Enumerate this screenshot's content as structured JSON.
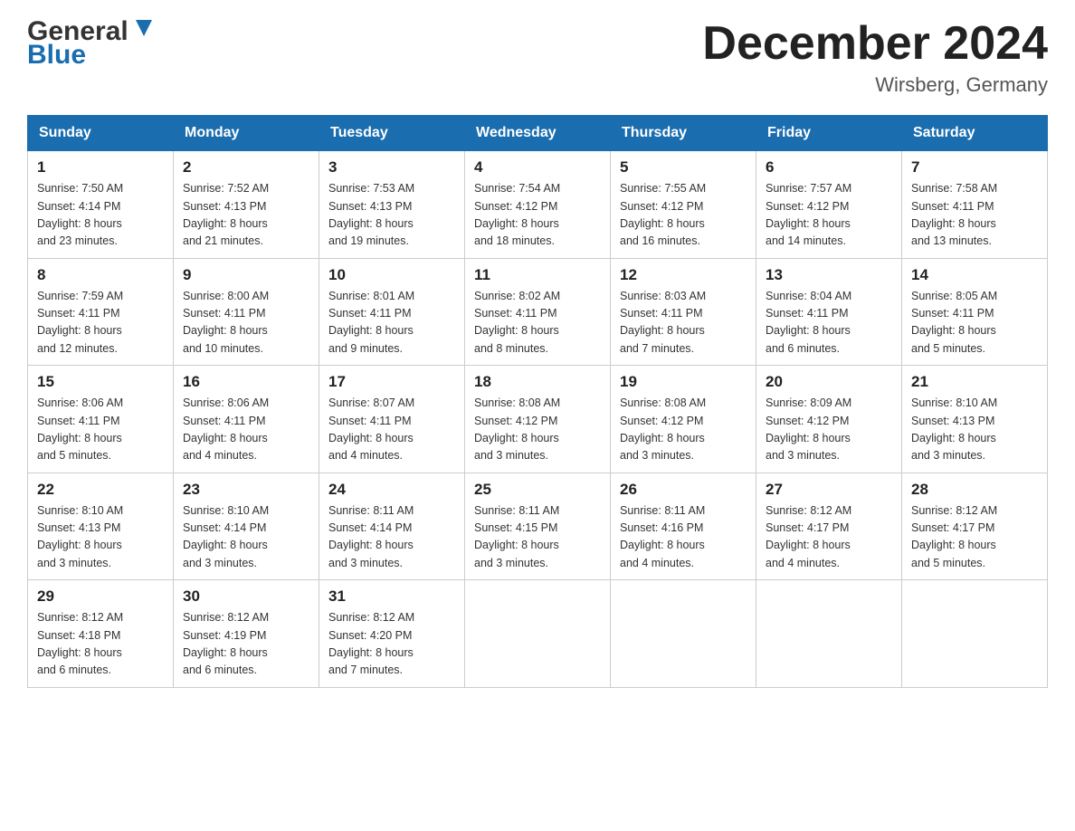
{
  "header": {
    "logo_line1": "General",
    "logo_line2": "Blue",
    "title": "December 2024",
    "subtitle": "Wirsberg, Germany"
  },
  "weekdays": [
    "Sunday",
    "Monday",
    "Tuesday",
    "Wednesday",
    "Thursday",
    "Friday",
    "Saturday"
  ],
  "weeks": [
    [
      {
        "day": "1",
        "sunrise": "7:50 AM",
        "sunset": "4:14 PM",
        "daylight": "8 hours and 23 minutes."
      },
      {
        "day": "2",
        "sunrise": "7:52 AM",
        "sunset": "4:13 PM",
        "daylight": "8 hours and 21 minutes."
      },
      {
        "day": "3",
        "sunrise": "7:53 AM",
        "sunset": "4:13 PM",
        "daylight": "8 hours and 19 minutes."
      },
      {
        "day": "4",
        "sunrise": "7:54 AM",
        "sunset": "4:12 PM",
        "daylight": "8 hours and 18 minutes."
      },
      {
        "day": "5",
        "sunrise": "7:55 AM",
        "sunset": "4:12 PM",
        "daylight": "8 hours and 16 minutes."
      },
      {
        "day": "6",
        "sunrise": "7:57 AM",
        "sunset": "4:12 PM",
        "daylight": "8 hours and 14 minutes."
      },
      {
        "day": "7",
        "sunrise": "7:58 AM",
        "sunset": "4:11 PM",
        "daylight": "8 hours and 13 minutes."
      }
    ],
    [
      {
        "day": "8",
        "sunrise": "7:59 AM",
        "sunset": "4:11 PM",
        "daylight": "8 hours and 12 minutes."
      },
      {
        "day": "9",
        "sunrise": "8:00 AM",
        "sunset": "4:11 PM",
        "daylight": "8 hours and 10 minutes."
      },
      {
        "day": "10",
        "sunrise": "8:01 AM",
        "sunset": "4:11 PM",
        "daylight": "8 hours and 9 minutes."
      },
      {
        "day": "11",
        "sunrise": "8:02 AM",
        "sunset": "4:11 PM",
        "daylight": "8 hours and 8 minutes."
      },
      {
        "day": "12",
        "sunrise": "8:03 AM",
        "sunset": "4:11 PM",
        "daylight": "8 hours and 7 minutes."
      },
      {
        "day": "13",
        "sunrise": "8:04 AM",
        "sunset": "4:11 PM",
        "daylight": "8 hours and 6 minutes."
      },
      {
        "day": "14",
        "sunrise": "8:05 AM",
        "sunset": "4:11 PM",
        "daylight": "8 hours and 5 minutes."
      }
    ],
    [
      {
        "day": "15",
        "sunrise": "8:06 AM",
        "sunset": "4:11 PM",
        "daylight": "8 hours and 5 minutes."
      },
      {
        "day": "16",
        "sunrise": "8:06 AM",
        "sunset": "4:11 PM",
        "daylight": "8 hours and 4 minutes."
      },
      {
        "day": "17",
        "sunrise": "8:07 AM",
        "sunset": "4:11 PM",
        "daylight": "8 hours and 4 minutes."
      },
      {
        "day": "18",
        "sunrise": "8:08 AM",
        "sunset": "4:12 PM",
        "daylight": "8 hours and 3 minutes."
      },
      {
        "day": "19",
        "sunrise": "8:08 AM",
        "sunset": "4:12 PM",
        "daylight": "8 hours and 3 minutes."
      },
      {
        "day": "20",
        "sunrise": "8:09 AM",
        "sunset": "4:12 PM",
        "daylight": "8 hours and 3 minutes."
      },
      {
        "day": "21",
        "sunrise": "8:10 AM",
        "sunset": "4:13 PM",
        "daylight": "8 hours and 3 minutes."
      }
    ],
    [
      {
        "day": "22",
        "sunrise": "8:10 AM",
        "sunset": "4:13 PM",
        "daylight": "8 hours and 3 minutes."
      },
      {
        "day": "23",
        "sunrise": "8:10 AM",
        "sunset": "4:14 PM",
        "daylight": "8 hours and 3 minutes."
      },
      {
        "day": "24",
        "sunrise": "8:11 AM",
        "sunset": "4:14 PM",
        "daylight": "8 hours and 3 minutes."
      },
      {
        "day": "25",
        "sunrise": "8:11 AM",
        "sunset": "4:15 PM",
        "daylight": "8 hours and 3 minutes."
      },
      {
        "day": "26",
        "sunrise": "8:11 AM",
        "sunset": "4:16 PM",
        "daylight": "8 hours and 4 minutes."
      },
      {
        "day": "27",
        "sunrise": "8:12 AM",
        "sunset": "4:17 PM",
        "daylight": "8 hours and 4 minutes."
      },
      {
        "day": "28",
        "sunrise": "8:12 AM",
        "sunset": "4:17 PM",
        "daylight": "8 hours and 5 minutes."
      }
    ],
    [
      {
        "day": "29",
        "sunrise": "8:12 AM",
        "sunset": "4:18 PM",
        "daylight": "8 hours and 6 minutes."
      },
      {
        "day": "30",
        "sunrise": "8:12 AM",
        "sunset": "4:19 PM",
        "daylight": "8 hours and 6 minutes."
      },
      {
        "day": "31",
        "sunrise": "8:12 AM",
        "sunset": "4:20 PM",
        "daylight": "8 hours and 7 minutes."
      },
      null,
      null,
      null,
      null
    ]
  ],
  "labels": {
    "sunrise": "Sunrise:",
    "sunset": "Sunset:",
    "daylight": "Daylight:"
  }
}
